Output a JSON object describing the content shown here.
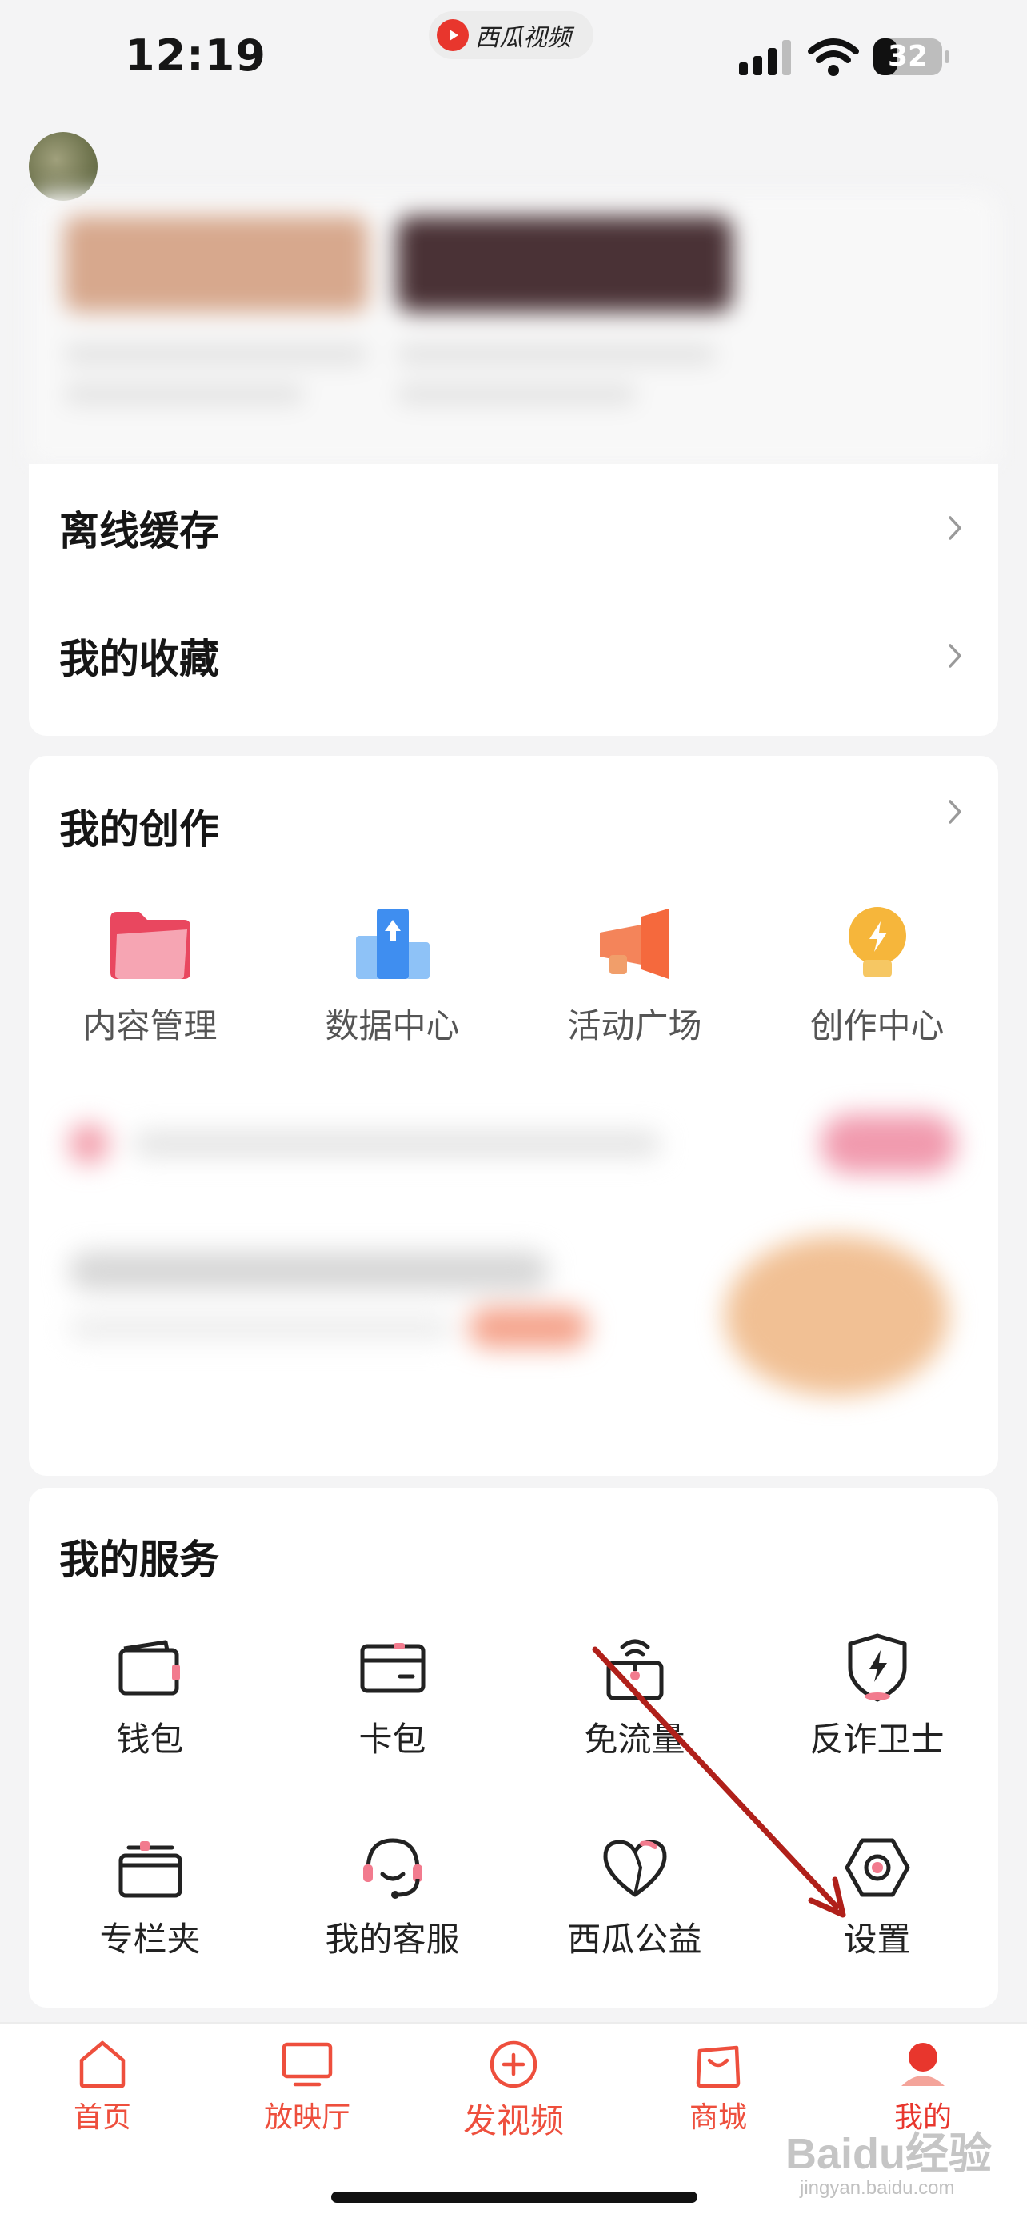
{
  "status_bar": {
    "time": "12:19",
    "app_name": "西瓜视频",
    "battery": "32"
  },
  "top_list": {
    "items": [
      {
        "label": "离线缓存",
        "icon": "chevron-right-icon"
      },
      {
        "label": "我的收藏",
        "icon": "chevron-right-icon"
      }
    ]
  },
  "creation": {
    "title": "我的创作",
    "items": [
      {
        "label": "内容管理",
        "icon": "folder-icon"
      },
      {
        "label": "数据中心",
        "icon": "data-chart-icon"
      },
      {
        "label": "活动广场",
        "icon": "megaphone-icon"
      },
      {
        "label": "创作中心",
        "icon": "lightbulb-icon"
      }
    ]
  },
  "services": {
    "title": "我的服务",
    "row1": [
      {
        "label": "钱包",
        "icon": "wallet-icon"
      },
      {
        "label": "卡包",
        "icon": "card-icon"
      },
      {
        "label": "免流量",
        "icon": "free-data-icon"
      },
      {
        "label": "反诈卫士",
        "icon": "shield-icon"
      }
    ],
    "row2": [
      {
        "label": "专栏夹",
        "icon": "folder-outline-icon"
      },
      {
        "label": "我的客服",
        "icon": "headset-icon"
      },
      {
        "label": "西瓜公益",
        "icon": "heart-icon"
      },
      {
        "label": "设置",
        "icon": "settings-hex-icon"
      }
    ]
  },
  "tab_bar": {
    "tabs": [
      {
        "label": "首页",
        "icon": "home-icon"
      },
      {
        "label": "放映厅",
        "icon": "tv-icon"
      },
      {
        "label": "发视频",
        "icon": "plus-circle-icon"
      },
      {
        "label": "商城",
        "icon": "shopping-bag-icon"
      },
      {
        "label": "我的",
        "icon": "profile-icon",
        "active": true
      }
    ]
  },
  "watermark": {
    "brand": "Baidu经验",
    "url": "jingyan.baidu.com"
  },
  "colors": {
    "accent": "#e8362d",
    "annotation_arrow": "#b0201a"
  }
}
